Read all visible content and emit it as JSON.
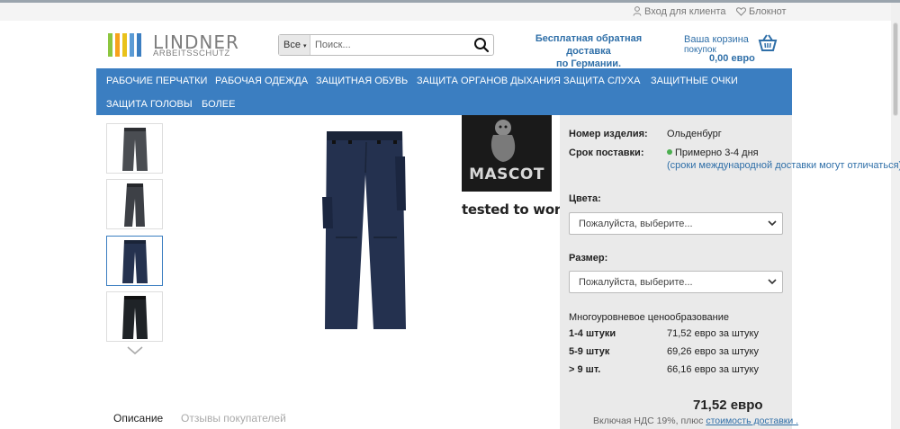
{
  "topbar": {
    "login": "Вход для клиента",
    "notebook": "Блокнот"
  },
  "logo": {
    "name": "LINDNER",
    "sub": "ARBEITSSCHUTZ"
  },
  "search": {
    "category": "Все",
    "placeholder": "Поиск..."
  },
  "shipping": {
    "line1": "Бесплатная обратная доставка",
    "line2": "по Германии."
  },
  "cart": {
    "line1": "Ваша корзина",
    "line2": "покупок",
    "amount": "0,00 евро"
  },
  "nav": {
    "items": [
      "РАБОЧИЕ ПЕРЧАТКИ",
      "РАБОЧАЯ ОДЕЖДА",
      "ЗАЩИТНАЯ ОБУВЬ",
      "ЗАЩИТА ОРГАНОВ ДЫХАНИЯ",
      "ЗАЩИТА СЛУХА",
      "ЗАЩИТНЫЕ ОЧКИ",
      "ЗАЩИТА ГОЛОВЫ",
      "БОЛЕЕ"
    ]
  },
  "brand": {
    "logo_text": "MASCOT",
    "tagline": "tested to work"
  },
  "product": {
    "article_label": "Номер изделия:",
    "article_value": "Ольденбург",
    "delivery_label": "Срок поставки:",
    "delivery_value": "Примерно 3-4 дня",
    "delivery_note": "(сроки международной доставки могут отличаться).",
    "colors_label": "Цвета:",
    "colors_placeholder": "Пожалуйста, выберите...",
    "size_label": "Размер:",
    "size_placeholder": "Пожалуйста, выберите...",
    "tier_title": "Многоуровневое ценообразование",
    "tiers": [
      {
        "qty": "1-4 штуки",
        "price": "71,52 евро за штуку"
      },
      {
        "qty": "5-9 штук",
        "price": "69,26 евро за штуку"
      },
      {
        "qty": "> 9 шт.",
        "price": "66,16 евро за штуку"
      }
    ],
    "price": "71,52 евро",
    "vat_text": "Включая НДС 19%, плюс",
    "vat_link": "стоимость доставки ."
  },
  "tabs": {
    "description": "Описание",
    "reviews": "Отзывы покупателей"
  },
  "colors": {
    "accent": "#3b7ec1",
    "link": "#2f6fa8",
    "navy": "#1f2d4a"
  }
}
